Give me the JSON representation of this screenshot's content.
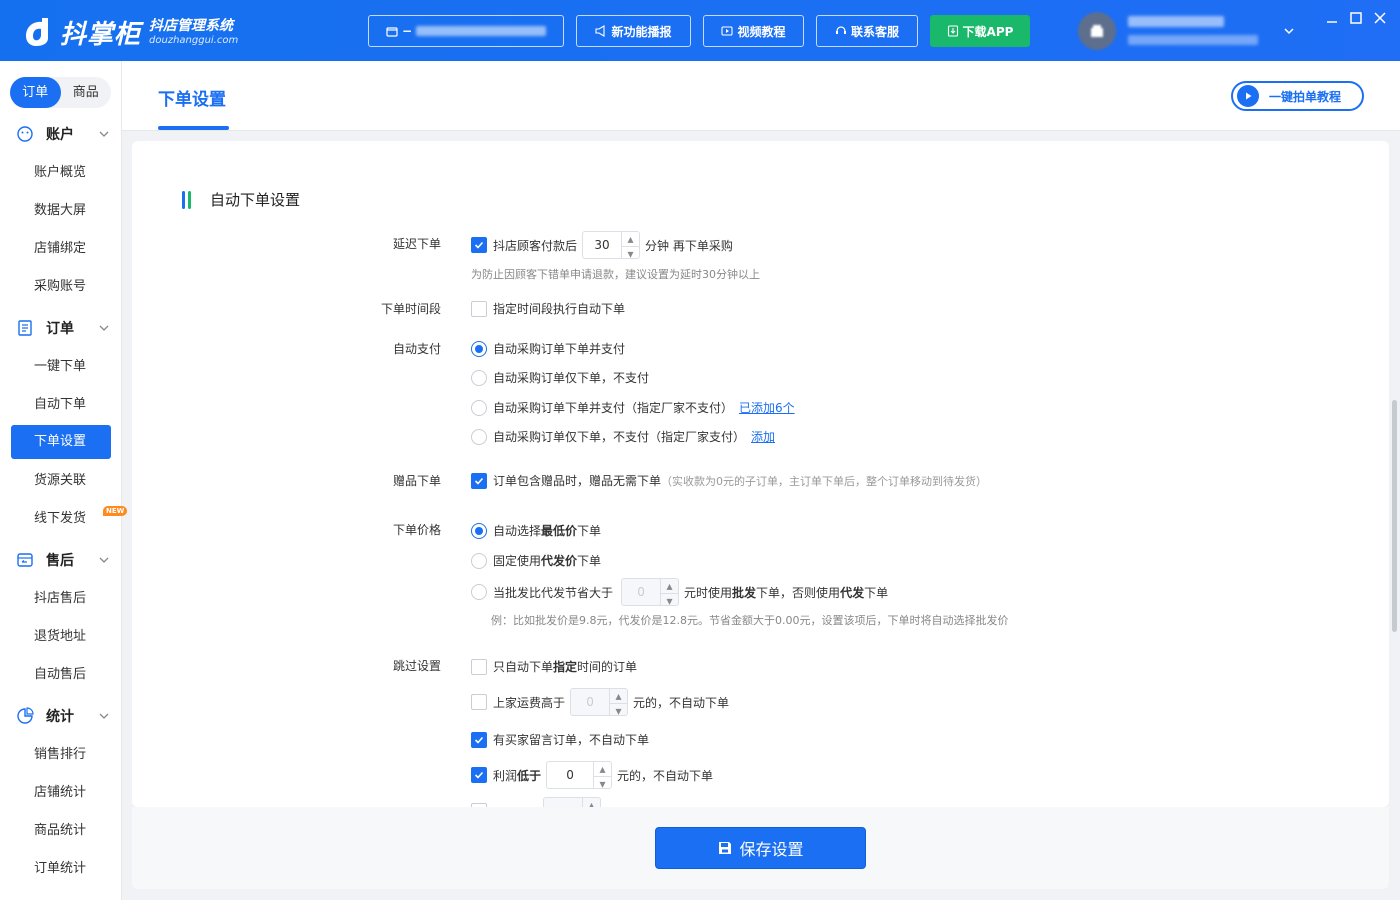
{
  "header": {
    "logo_name": "抖掌柜",
    "logo_sub1": "抖店管理系统",
    "logo_sub2": "douzhanggui.com",
    "shop_prefix": "−",
    "buttons": {
      "new_feature": "新功能播报",
      "video": "视频教程",
      "service": "联系客服",
      "download": "下载APP"
    },
    "colors": {
      "bar": "#1a6ff2",
      "download_bg": "#19b86b"
    }
  },
  "sidebar": {
    "seg_order": "订单",
    "seg_goods": "商品",
    "sections": [
      {
        "title": "账户",
        "icon": "smile-icon",
        "items": [
          "账户概览",
          "数据大屏",
          "店铺绑定",
          "采购账号"
        ]
      },
      {
        "title": "订单",
        "icon": "list-doc-icon",
        "items": [
          "一键下单",
          "自动下单",
          "下单设置",
          "货源关联",
          "线下发货"
        ]
      },
      {
        "title": "售后",
        "icon": "return-box-icon",
        "items": [
          "抖店售后",
          "退货地址",
          "自动售后"
        ]
      },
      {
        "title": "统计",
        "icon": "pie-chart-icon",
        "items": [
          "销售排行",
          "店铺统计",
          "商品统计",
          "订单统计"
        ]
      }
    ],
    "new_badge": "NEW",
    "active_item": "下单设置",
    "accent": "#1a6ff2"
  },
  "tabbar": {
    "tab": "下单设置",
    "tutorial": "一键拍单教程"
  },
  "form": {
    "title": "自动下单设置",
    "delay": {
      "label": "延迟下单",
      "text_before": "抖店顾客付款后",
      "value": "30",
      "text_after": "分钟 再下单采购",
      "hint": "为防止因顾客下错单申请退款，建议设置为延时30分钟以上"
    },
    "time_range": {
      "label": "下单时间段",
      "text": "指定时间段执行自动下单"
    },
    "auto_pay": {
      "label": "自动支付",
      "opt1": "自动采购订单下单并支付",
      "opt2": "自动采购订单仅下单，不支付",
      "opt3": "自动采购订单下单并支付（指定厂家不支付）",
      "opt3_link": "已添加6个",
      "opt4": "自动采购订单仅下单，不支付（指定厂家支付）",
      "opt4_link": "添加"
    },
    "gift": {
      "label": "赠品下单",
      "text": "订单包含赠品时，赠品无需下单",
      "note": "（实收款为0元的子订单，主订单下单后，整个订单移动到待发货）"
    },
    "price": {
      "label": "下单价格",
      "opt1_a": "自动选择",
      "opt1_b": "最低价",
      "opt1_c": "下单",
      "opt2_a": "固定使用",
      "opt2_b": "代发价",
      "opt2_c": "下单",
      "opt3_a": "当批发比代发节省大于",
      "opt3_value": "0",
      "opt3_b": "元时使用",
      "opt3_c": "批发",
      "opt3_d": "下单，否则使用",
      "opt3_e": "代发",
      "opt3_f": "下单",
      "hint": "例：比如批发价是9.8元，代发价是12.8元。节省金额大于0.00元，设置该项后，下单时将自动选择批发价"
    },
    "skip": {
      "label": "跳过设置",
      "opt1_a": "只自动下单 ",
      "opt1_b": "指定",
      "opt1_c": " 时间的订单",
      "opt2_a": "上家运费高于",
      "opt2_value": "0",
      "opt2_b": "元的，不自动下单",
      "opt3": "有买家留言订单，不自动下单",
      "opt4_a": "利润",
      "opt4_b": "低于",
      "opt4_value": "0",
      "opt4_c": "元的，不自动下单"
    }
  },
  "footer": {
    "save": "保存设置"
  }
}
